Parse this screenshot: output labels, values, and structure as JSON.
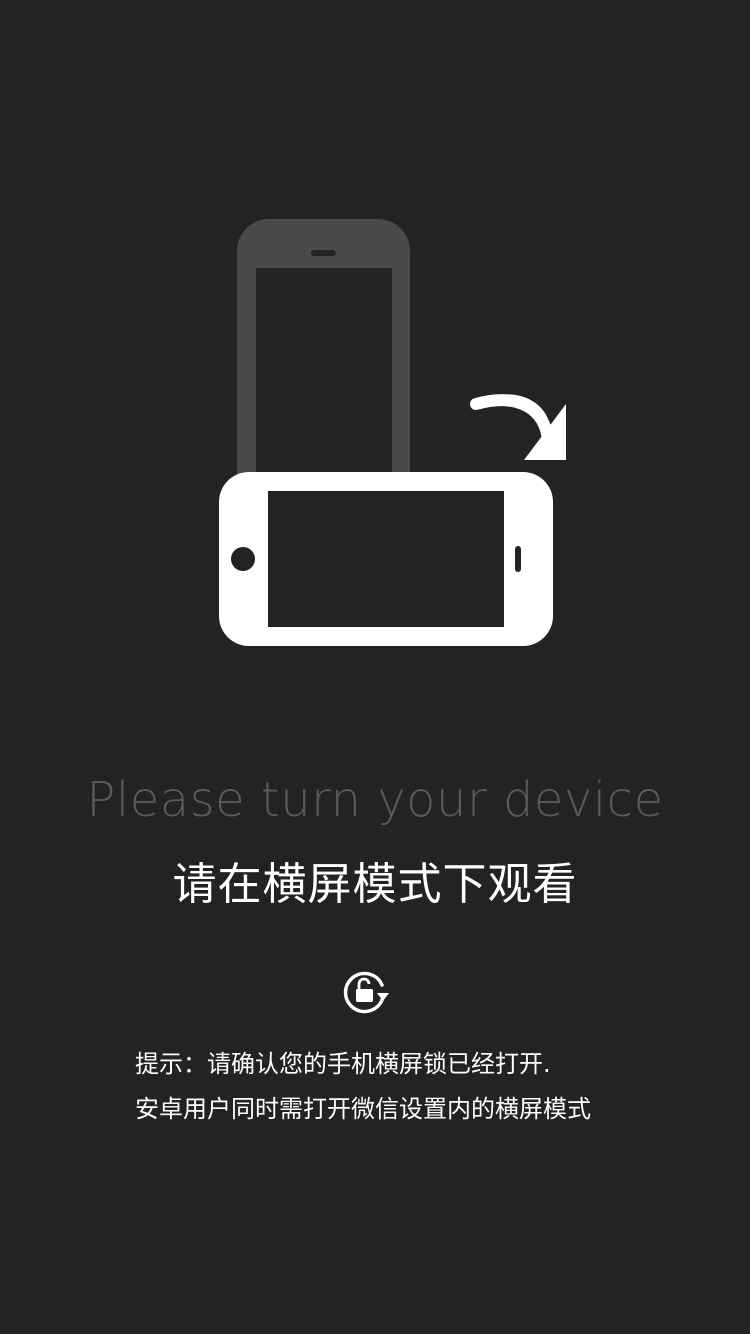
{
  "illustration": {
    "icon": "phone-rotate-to-landscape",
    "arrow_icon": "curved-arrow-icon"
  },
  "headline": {
    "english": "Please turn your device",
    "chinese": "请在横屏模式下观看"
  },
  "orientation_lock": {
    "icon": "orientation-lock-icon"
  },
  "tips": {
    "line1": "提示：请确认您的手机横屏锁已经打开.",
    "line2": "安卓用户同时需打开微信设置内的横屏模式"
  },
  "colors": {
    "background": "#232323",
    "ghost_phone": "#4a4a4a",
    "foreground": "#ffffff",
    "subtitle": "#5a5a5a"
  }
}
